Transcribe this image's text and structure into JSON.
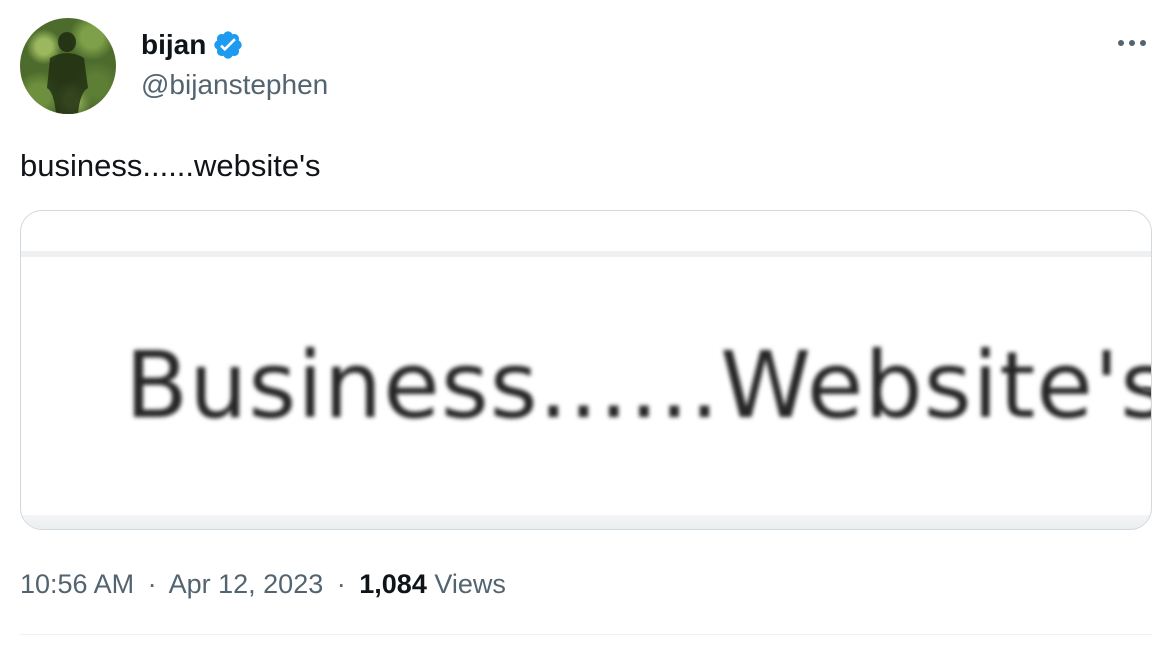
{
  "author": {
    "display_name": "bijan",
    "handle": "@bijanstephen",
    "verified": true,
    "avatar_icon": "avatar-shadow-photo"
  },
  "tweet": {
    "text": "business......website's"
  },
  "media": {
    "image_text": "Business......Website's"
  },
  "meta": {
    "time": "10:56 AM",
    "separator": "·",
    "date": "Apr 12, 2023",
    "views_count": "1,084",
    "views_label": "Views"
  },
  "icons": {
    "verified": "verified-badge-icon",
    "more": "more-options-icon"
  },
  "colors": {
    "verified_blue": "#1d9bf0",
    "secondary_text": "#536471",
    "primary_text": "#0f1419",
    "border": "#cfd9de"
  }
}
